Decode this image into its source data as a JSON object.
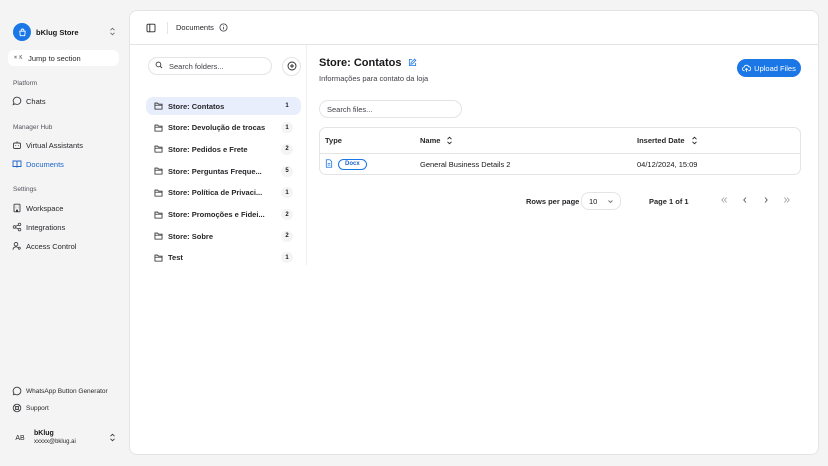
{
  "sidebar": {
    "store_name": "bKlug Store",
    "jump_kbd": "⌘ K",
    "jump_label": "Jump to section",
    "groups": {
      "platform": "Platform",
      "manager_hub": "Manager Hub",
      "settings": "Settings"
    },
    "items": {
      "chats": "Chats",
      "virtual_assistants": "Virtual Assistants",
      "documents": "Documents",
      "workspace": "Workspace",
      "integrations": "Integrations",
      "access_control": "Access Control",
      "whatsapp_button_generator": "WhatsApp Button Generator",
      "support": "Support"
    },
    "user": {
      "initials": "AB",
      "name": "bKlug",
      "email": "xxxxx@bklug.ai"
    }
  },
  "header": {
    "breadcrumb": "Documents"
  },
  "folders": {
    "search_placeholder": "Search folders...",
    "items": [
      {
        "label": "Store: Contatos",
        "count": "1",
        "active": true
      },
      {
        "label": "Store: Devolução de trocas",
        "count": "1"
      },
      {
        "label": "Store: Pedidos e Frete",
        "count": "2"
      },
      {
        "label": "Store: Perguntas Freque...",
        "count": "5"
      },
      {
        "label": "Store: Política de Privaci...",
        "count": "1"
      },
      {
        "label": "Store: Promoções e Fidei...",
        "count": "2"
      },
      {
        "label": "Store: Sobre",
        "count": "2"
      },
      {
        "label": "Test",
        "count": "1"
      }
    ]
  },
  "content": {
    "title": "Store: Contatos",
    "subtitle": "Informações para contato da loja",
    "upload_label": "Upload Files",
    "file_search_placeholder": "Search files...",
    "table": {
      "columns": [
        "Type",
        "Name",
        "Inserted Date"
      ],
      "rows": [
        {
          "type": "Docx",
          "name": "General Business Details 2",
          "inserted_date": "04/12/2024, 15:09"
        }
      ]
    },
    "pagination": {
      "rows_per_page_label": "Rows per page",
      "rows_per_page_value": "10",
      "page_label": "Page 1 of 1"
    }
  },
  "colors": {
    "accent": "#1b76e6",
    "active_bg": "#e8eefb"
  }
}
